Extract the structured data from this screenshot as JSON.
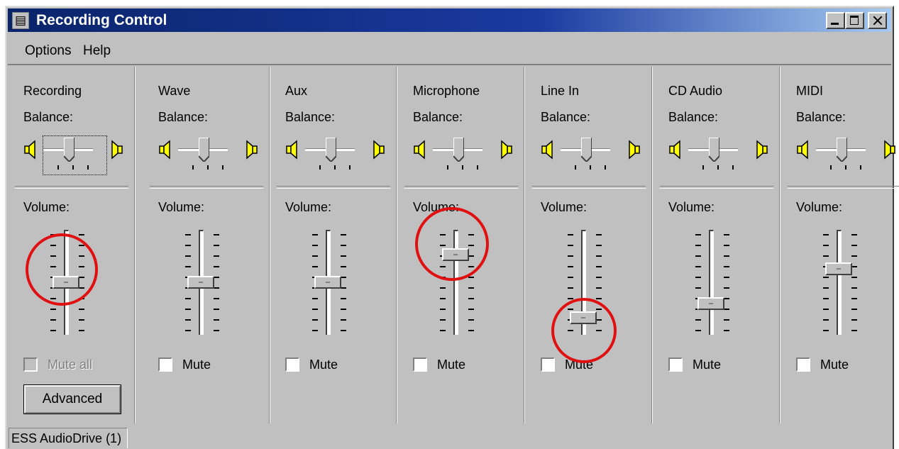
{
  "window": {
    "title": "Recording Control",
    "app_icon": "mixer-icon"
  },
  "menu": [
    {
      "label": "Options"
    },
    {
      "label": "Help"
    }
  ],
  "panels": [
    {
      "name": "Recording",
      "balance_label": "Balance:",
      "volume_label": "Volume:",
      "volume_level": 0.5,
      "balance_level": 0.5,
      "checkbox_label": "Mute all",
      "checked": false,
      "disabled": true,
      "button_label": "Advanced"
    },
    {
      "name": "Wave",
      "balance_label": "Balance:",
      "volume_label": "Volume:",
      "volume_level": 0.5,
      "balance_level": 0.5,
      "checkbox_label": "Mute",
      "checked": false
    },
    {
      "name": "Aux",
      "balance_label": "Balance:",
      "volume_label": "Volume:",
      "volume_level": 0.5,
      "balance_level": 0.5,
      "checkbox_label": "Mute",
      "checked": false
    },
    {
      "name": "Microphone",
      "balance_label": "Balance:",
      "volume_label": "Volume:",
      "volume_level": 0.83,
      "balance_level": 0.5,
      "checkbox_label": "Mute",
      "checked": false
    },
    {
      "name": "Line In",
      "balance_label": "Balance:",
      "volume_label": "Volume:",
      "volume_level": 0.08,
      "balance_level": 0.5,
      "checkbox_label": "Mute",
      "checked": false
    },
    {
      "name": "CD Audio",
      "balance_label": "Balance:",
      "volume_label": "Volume:",
      "volume_level": 0.25,
      "balance_level": 0.5,
      "checkbox_label": "Mute",
      "checked": false
    },
    {
      "name": "MIDI",
      "balance_label": "Balance:",
      "volume_label": "Volume:",
      "volume_level": 0.66,
      "balance_level": 0.5,
      "checkbox_label": "Mute",
      "checked": false
    }
  ],
  "status": {
    "text": "ESS AudioDrive (1)"
  },
  "annotations": {
    "circle_color": "#e01010",
    "circled_controls": [
      "Recording volume thumb",
      "Microphone volume thumb",
      "Line In volume thumb"
    ]
  }
}
